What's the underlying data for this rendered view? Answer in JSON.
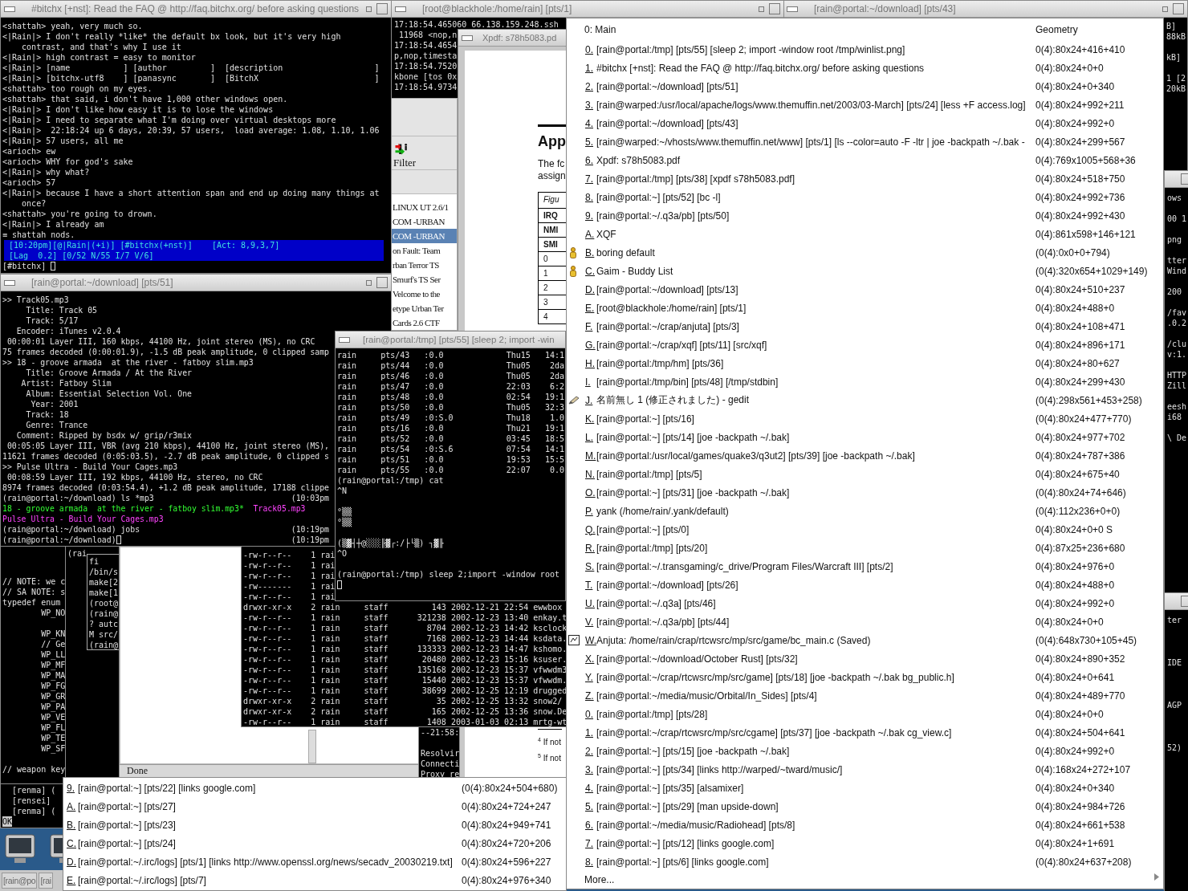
{
  "irc_window": {
    "title": "#bitchx [+nst]: Read the FAQ @ http://faq.bitchx.org/ before asking questions",
    "lines": [
      "<shattah> yeah, very much so.",
      "<|Rain|> I don't really *like* the default bx look, but it's very high",
      "    contrast, and that's why I use it",
      "<|Rain|> high contrast = easy to monitor",
      "<|Rain|> [name           ] [author         ]  [description                   ]",
      "<|Rain|> [bitchx-utf8    ] [panasync       ]  [BitchX                        ]",
      "<shattah> too rough on my eyes.",
      "<shattah> that said, i don't have 1,000 other windows open.",
      "<|Rain|> I don't like how easy it is to lose the windows",
      "<|Rain|> I need to separate what I'm doing over virtual desktops more",
      "<|Rain|>  22:18:24 up 6 days, 20:39, 57 users,  load average: 1.08, 1.10, 1.06",
      "<|Rain|> 57 users, all me",
      "<arioch> ew",
      "<arioch> WHY for god's sake",
      "<|Rain|> why what?",
      "<arioch> 57",
      "<|Rain|> because I have a short attention span and end up doing many things at",
      "    once?",
      "<shattah> you're going to drown.",
      "<|Rain|> I already am",
      "≡ shattah nods."
    ],
    "status_lines": [
      " [10:20pm][@|Rain|(+i)] [#bitchx(+nst)]    [Act: 8,9,3,7]",
      " [Lag  0.2] [0/52 N/55 I/7 V/6]"
    ],
    "prompt": "[#bitchx]"
  },
  "mp3_window": {
    "title": "[rain@portal:~/download] [pts/51]",
    "lines": [
      {
        "kind": "text",
        "text": ">> Track05.mp3"
      },
      {
        "kind": "text",
        "text": "     Title: Track 05"
      },
      {
        "kind": "text",
        "text": "     Track: 5/17"
      },
      {
        "kind": "text",
        "text": "   Encoder: iTunes v2.0.4"
      },
      {
        "kind": "text",
        "text": " 00:00:01 Layer III, 160 kbps, 44100 Hz, joint stereo (MS), no CRC"
      },
      {
        "kind": "text",
        "text": "75 frames decoded (0:00:01.9), -1.5 dB peak amplitude, 0 clipped samp"
      },
      {
        "kind": "text",
        "text": ">> 18 - groove armada  at the river - fatboy slim.mp3"
      },
      {
        "kind": "text",
        "text": "     Title: Groove Armada / At the River"
      },
      {
        "kind": "text",
        "text": "    Artist: Fatboy Slim"
      },
      {
        "kind": "text",
        "text": "     Album: Essential Selection Vol. One"
      },
      {
        "kind": "text",
        "text": "      Year: 2001"
      },
      {
        "kind": "text",
        "text": "     Track: 18"
      },
      {
        "kind": "text",
        "text": "     Genre: Trance"
      },
      {
        "kind": "text",
        "text": "   Comment: Ripped by bsdx w/ grip/r3mix"
      },
      {
        "kind": "text",
        "text": " 00:05:05 Layer III, VBR (avg 210 kbps), 44100 Hz, joint stereo (MS),"
      },
      {
        "kind": "text",
        "text": "11621 frames decoded (0:05:03.5), -2.7 dB peak amplitude, 0 clipped s"
      },
      {
        "kind": "text",
        "text": ">> Pulse Ultra - Build Your Cages.mp3"
      },
      {
        "kind": "text",
        "text": " 00:08:59 Layer III, 192 kbps, 44100 Hz, stereo, no CRC"
      },
      {
        "kind": "text",
        "text": "8974 frames decoded (0:03:54.4), +1.2 dB peak amplitude, 17188 clippe"
      },
      {
        "kind": "prompt",
        "text": "(rain@portal:~/download) ls *mp3",
        "time": "(10:03pm",
        "cursor": false
      },
      {
        "kind": "files",
        "files": [
          {
            "name": "18 - groove armada  at the river - fatboy slim.mp3*",
            "color": "#33ff33"
          },
          {
            "name": "Track05.mp3",
            "color": "#ff44ff"
          }
        ]
      },
      {
        "kind": "files",
        "files": [
          {
            "name": "Pulse Ultra - Build Your Cages.mp3",
            "color": "#ff44ff"
          }
        ]
      },
      {
        "kind": "prompt",
        "text": "(rain@portal:~/download) jobs",
        "time": "(10:19pm",
        "cursor": false
      },
      {
        "kind": "prompt",
        "text": "(rain@portal:~/download)",
        "time": "(10:19pm",
        "cursor": true
      }
    ]
  },
  "tcpdump_window": {
    "title": "[root@blackhole:/home/rain] [pts/1]",
    "lines": [
      "17:18:54.465060 66.138.159.248.ssh",
      " 11968 <nop,n",
      "17:18:54.4654",
      "p,nop,timesta",
      "17:18:54.7520",
      "kbone [tos 0x",
      "17:18:54.9734"
    ]
  },
  "download_window": {
    "title": "[rain@portal:~/download] [pts/43]",
    "blocks": [
      [
        "B]",
        "88kB"
      ],
      [
        "kB]"
      ],
      [
        "1 [2",
        "20kB"
      ]
    ]
  },
  "server_browser": {
    "toolbar_label": "Filter",
    "rows": [
      {
        "text": "LINUX UT 2.6/1",
        "selected": false
      },
      {
        "text": "COM -URBAN",
        "selected": false
      },
      {
        "text": "COM -URBAN",
        "selected": true
      },
      {
        "text": "on Fault: Team",
        "selected": false
      },
      {
        "text": "rban Terror TS",
        "selected": false
      },
      {
        "text": "Smurf's TS Ser",
        "selected": false
      },
      {
        "text": "Velcome to the",
        "selected": false
      },
      {
        "text": "etype Urban Ter",
        "selected": false
      },
      {
        "text": "Cards 2.6 CTF",
        "selected": false
      }
    ]
  },
  "xpdf_window": {
    "title": "Xpdf: s78h5083.pd",
    "heading": "App",
    "paragraph": [
      "The fc",
      "assign"
    ],
    "table_rows": [
      "Figu",
      "IRQ",
      "NMI",
      "SMI",
      "0",
      "1",
      "2",
      "3",
      "4"
    ],
    "footnotes": [
      {
        "mark": "4",
        "text": "If not"
      },
      {
        "mark": "5",
        "text": "If not"
      }
    ]
  },
  "who_window": {
    "title": "[rain@portal:/tmp] [pts/55] [sleep 2; import -win",
    "blocks": [
      [
        "rain     pts/43   :0.0             Thu15   14:1",
        "rain     pts/44   :0.0             Thu05    2da",
        "rain     pts/46   :0.0             Thu05    2da",
        "rain     pts/47   :0.0             22:03    6:2",
        "rain     pts/48   :0.0             02:54   19:1",
        "rain     pts/50   :0.0             Thu05   32:3",
        "rain     pts/49   :0:S.0           Thu18    1.0",
        "rain     pts/16   :0.0             Thu21   19:1",
        "rain     pts/52   :0.0             03:45   18:5",
        "rain     pts/54   :0:S.6           07:54   14:1",
        "rain     pts/51   :0.0             19:53   15:5",
        "rain     pts/55   :0.0             22:07    0.0",
        "(rain@portal:/tmp) cat",
        "^N"
      ],
      [
        "°▒▒",
        "°▒▒"
      ],
      [
        "(▒▓┤┼@░░░╟▓┌:/├└▒) ┐▓╟",
        "^O"
      ],
      [
        "(rain@portal:/tmp) sleep 2;import -window root"
      ]
    ],
    "cursor": true
  },
  "ls_window": {
    "lines": [
      "-rw-r--r--    1 rai",
      "-rw-r--r--    1 rai",
      "-rw-r--r--    1 rai",
      "-rw-------    1 rai",
      "-rw-r--r--    1 rai",
      "drwxr-xr-x    2 rain     staff         143 2002-12-21 22:54 ewwbox",
      "-rw-r--r--    1 rain     staff      321238 2002-12-23 13:40 enkay.t",
      "-rw-r--r--    1 rain     staff        8704 2002-12-23 14:42 ksclock",
      "-rw-r--r--    1 rain     staff        7168 2002-12-23 14:44 ksdata.",
      "-rw-r--r--    1 rain     staff      133333 2002-12-23 14:47 kshomo.",
      "-rw-r--r--    1 rain     staff       20480 2002-12-23 15:16 ksuser.",
      "-rw-r--r--    1 rain     staff      135168 2002-12-23 15:37 vfwwdm3",
      "-rw-r--r--    1 rain     staff       15440 2002-12-23 15:37 vfwwdm.",
      "-rw-r--r--    1 rain     staff       38699 2002-12-25 12:19 drugged",
      "drwxr-xr-x    2 rain     staff          35 2002-12-25 13:32 snow2/",
      "drwxr-xr-x    2 rain     staff         165 2002-12-25 13:36 snow.De",
      "-rw-r--r--    1 rain     staff        1408 2003-01-03 02:13 mrtg-wt"
    ]
  },
  "code_window": {
    "blocks": [
      [
        "// NOTE: we c",
        "// SA NOTE: s",
        "typedef enum",
        "        WP_NO"
      ],
      [
        "        WP_KN",
        "        // Ge",
        "        WP_LL",
        "        WP_MF",
        "        WP_MA",
        "        WP_FG",
        "        WP_GR",
        "        WP_PA",
        "        WP_VE",
        "        WP_FL",
        "        WP_TE",
        "        WP_SF"
      ],
      [
        "// weapon key"
      ]
    ]
  },
  "shell_window": {
    "lines": [
      "(rai"
    ]
  },
  "make_window": {
    "lines": [
      "fi",
      "/bin/s",
      "make[2",
      "make[1",
      "(root@",
      "(rain@",
      "? autc",
      "M src/",
      "(rain@"
    ]
  },
  "web_browser": {
    "status": "Done"
  },
  "proxy_window": {
    "blocks": [
      [
        "--21:58:"
      ],
      [
        "Resolvir",
        "Connecti",
        "Proxy re"
      ]
    ]
  },
  "nick_window": {
    "lines": [
      "  [renma] (",
      "  [rensei]",
      "  [renma] (",
      "OK"
    ]
  },
  "side_windows": [
    {
      "blocks": [
        [
          "ows"
        ],
        [
          "00 1"
        ],
        [
          "png"
        ],
        [
          "tter",
          "Wind"
        ],
        [
          "200"
        ],
        [
          "/fav",
          ".0.2"
        ],
        [
          "/clu",
          "v:1."
        ],
        [
          "HTTP",
          "Zill"
        ],
        [
          "eesh",
          "i68"
        ],
        [
          "\\ De"
        ]
      ]
    },
    {
      "blocks": [
        [
          "ter"
        ],
        [
          "IDE"
        ],
        [
          "AGP"
        ],
        [
          "52)"
        ]
      ]
    }
  ],
  "window_menu": {
    "header": {
      "title": "0: Main",
      "column": "Geometry"
    },
    "items": [
      {
        "kind": "plain",
        "key": "0.",
        "label": "[rain@portal:/tmp] [pts/55] [sleep 2; import -window root /tmp/winlist.png]",
        "geometry": "0(4):80x24+416+410"
      },
      {
        "kind": "plain",
        "key": "1.",
        "label": "#bitchx [+nst]: Read the FAQ @ http://faq.bitchx.org/ before asking questions",
        "geometry": "0(4):80x24+0+0"
      },
      {
        "kind": "plain",
        "key": "2.",
        "label": "[rain@portal:~/download] [pts/51]",
        "geometry": "0(4):80x24+0+340"
      },
      {
        "kind": "plain",
        "key": "3.",
        "label": "[rain@warped:/usr/local/apache/logs/www.themuffin.net/2003/03-March] [pts/24] [less +F access.log]",
        "geometry": "0(4):80x24+992+211"
      },
      {
        "kind": "plain",
        "key": "4.",
        "label": "[rain@portal:~/download] [pts/43]",
        "geometry": "0(4):80x24+992+0"
      },
      {
        "kind": "plain",
        "key": "5.",
        "label": "[rain@warped:~/vhosts/www.themuffin.net/www] [pts/1] [ls --color=auto -F -ltr | joe -backpath ~/.bak -",
        "geometry": "0(4):80x24+299+567"
      },
      {
        "kind": "plain",
        "key": "6.",
        "label": "Xpdf: s78h5083.pdf",
        "geometry": "0(4):769x1005+568+36"
      },
      {
        "kind": "plain",
        "key": "7.",
        "label": "[rain@portal:/tmp] [pts/38] [xpdf s78h5083.pdf]",
        "geometry": "0(4):80x24+518+750"
      },
      {
        "kind": "plain",
        "key": "8.",
        "label": "[rain@portal:~] [pts/52] [bc -l]",
        "geometry": "0(4):80x24+992+736"
      },
      {
        "kind": "plain",
        "key": "9.",
        "label": "[rain@portal:~/.q3a/pb] [pts/50]",
        "geometry": "0(4):80x24+992+430"
      },
      {
        "kind": "plain",
        "key": "A.",
        "label": "XQF",
        "geometry": "0(4):861x598+146+121"
      },
      {
        "kind": "chat",
        "key": "B.",
        "label": "boring default",
        "geometry": "(0(4):0x0+0+794)"
      },
      {
        "kind": "chat",
        "key": "C.",
        "label": "Gaim - Buddy List",
        "geometry": "(0(4):320x654+1029+149)"
      },
      {
        "kind": "plain",
        "key": "D.",
        "label": "[rain@portal:~/download] [pts/13]",
        "geometry": "0(4):80x24+510+237"
      },
      {
        "kind": "plain",
        "key": "E.",
        "label": "[root@blackhole:/home/rain] [pts/1]",
        "geometry": "0(4):80x24+488+0"
      },
      {
        "kind": "plain",
        "key": "F.",
        "label": "[rain@portal:~/crap/anjuta] [pts/3]",
        "geometry": "0(4):80x24+108+471"
      },
      {
        "kind": "plain",
        "key": "G.",
        "label": "[rain@portal:~/crap/xqf] [pts/11] [src/xqf]",
        "geometry": "0(4):80x24+896+171"
      },
      {
        "kind": "plain",
        "key": "H.",
        "label": "[rain@portal:/tmp/hm] [pts/36]",
        "geometry": "0(4):80x24+80+627"
      },
      {
        "kind": "plain",
        "key": "I.",
        "label": "[rain@portal:/tmp/bin] [pts/48] [/tmp/stdbin]",
        "geometry": "0(4):80x24+299+430"
      },
      {
        "kind": "editor",
        "key": "J.",
        "label": "名前無し 1 (修正されました) - gedit",
        "geometry": "(0(4):298x561+453+258)"
      },
      {
        "kind": "plain",
        "key": "K.",
        "label": "[rain@portal:~] [pts/16]",
        "geometry": "(0(4):80x24+477+770)"
      },
      {
        "kind": "plain",
        "key": "L.",
        "label": "[rain@portal:~] [pts/14] [joe -backpath ~/.bak]",
        "geometry": "0(4):80x24+977+702"
      },
      {
        "kind": "plain",
        "key": "M.",
        "label": "[rain@portal:/usr/local/games/quake3/q3ut2] [pts/39] [joe -backpath ~/.bak]",
        "geometry": "0(4):80x24+787+386"
      },
      {
        "kind": "plain",
        "key": "N.",
        "label": "[rain@portal:/tmp] [pts/5]",
        "geometry": "0(4):80x24+675+40"
      },
      {
        "kind": "plain",
        "key": "O.",
        "label": "[rain@portal:~] [pts/31] [joe -backpath ~/.bak]",
        "geometry": "(0(4):80x24+74+646)"
      },
      {
        "kind": "plain",
        "key": "P.",
        "label": "yank (/home/rain/.yank/default)",
        "geometry": "(0(4):112x236+0+0)"
      },
      {
        "kind": "plain",
        "key": "Q.",
        "label": "[rain@portal:~] [pts/0]",
        "geometry": "0(4):80x24+0+0 S"
      },
      {
        "kind": "plain",
        "key": "R.",
        "label": "[rain@portal:/tmp] [pts/20]",
        "geometry": "0(4):87x25+236+680"
      },
      {
        "kind": "plain",
        "key": "S.",
        "label": "[rain@portal:~/.transgaming/c_drive/Program Files/Warcraft III] [pts/2]",
        "geometry": "0(4):80x24+976+0"
      },
      {
        "kind": "plain",
        "key": "T.",
        "label": "[rain@portal:~/download] [pts/26]",
        "geometry": "0(4):80x24+488+0"
      },
      {
        "kind": "plain",
        "key": "U.",
        "label": "[rain@portal:~/.q3a] [pts/46]",
        "geometry": "0(4):80x24+992+0"
      },
      {
        "kind": "plain",
        "key": "V.",
        "label": "[rain@portal:~/.q3a/pb] [pts/44]",
        "geometry": "0(4):80x24+0+0"
      },
      {
        "kind": "ide",
        "key": "W.",
        "label": "Anjuta: /home/rain/crap/rtcwsrc/mp/src/game/bc_main.c (Saved)",
        "geometry": "(0(4):648x730+105+45)"
      },
      {
        "kind": "plain",
        "key": "X.",
        "label": "[rain@portal:~/download/October Rust] [pts/32]",
        "geometry": "0(4):80x24+890+352"
      },
      {
        "kind": "plain",
        "key": "Y.",
        "label": "[rain@portal:~/crap/rtcwsrc/mp/src/game] [pts/18] [joe -backpath ~/.bak bg_public.h]",
        "geometry": "0(4):80x24+0+641"
      },
      {
        "kind": "plain",
        "key": "Z.",
        "label": "[rain@portal:~/media/music/Orbital/In_Sides] [pts/4]",
        "geometry": "0(4):80x24+489+770"
      },
      {
        "kind": "plain",
        "key": "0.",
        "label": "[rain@portal:/tmp] [pts/28]",
        "geometry": "0(4):80x24+0+0"
      },
      {
        "kind": "plain",
        "key": "1.",
        "label": "[rain@portal:~/crap/rtcwsrc/mp/src/cgame] [pts/37] [joe -backpath ~/.bak cg_view.c]",
        "geometry": "0(4):80x24+504+641"
      },
      {
        "kind": "plain",
        "key": "2.",
        "label": "[rain@portal:~] [pts/15] [joe -backpath ~/.bak]",
        "geometry": "0(4):80x24+992+0"
      },
      {
        "kind": "plain",
        "key": "3.",
        "label": "[rain@portal:~] [pts/34] [links http://warped/~tward/music/]",
        "geometry": "0(4):168x24+272+107"
      },
      {
        "kind": "plain",
        "key": "4.",
        "label": "[rain@portal:~] [pts/35] [alsamixer]",
        "geometry": "0(4):80x24+0+340"
      },
      {
        "kind": "plain",
        "key": "5.",
        "label": "[rain@portal:~] [pts/29] [man upside-down]",
        "geometry": "0(4):80x24+984+726"
      },
      {
        "kind": "plain",
        "key": "6.",
        "label": "[rain@portal:~/media/music/Radiohead] [pts/8]",
        "geometry": "0(4):80x24+661+538"
      },
      {
        "kind": "plain",
        "key": "7.",
        "label": "[rain@portal:~] [pts/12] [links google.com]",
        "geometry": "0(4):80x24+1+691"
      },
      {
        "kind": "plain",
        "key": "8.",
        "label": "[rain@portal:~] [pts/6] [links google.com]",
        "geometry": "(0(4):80x24+637+208)"
      }
    ],
    "more": "More..."
  },
  "bottom_menu": {
    "items": [
      {
        "key": "9.",
        "label": "[rain@portal:~] [pts/22] [links google.com]",
        "geometry": "(0(4):80x24+504+680)"
      },
      {
        "key": "A.",
        "label": "[rain@portal:~] [pts/27]",
        "geometry": "0(4):80x24+724+247"
      },
      {
        "key": "B.",
        "label": "[rain@portal:~] [pts/23]",
        "geometry": "0(4):80x24+949+741"
      },
      {
        "key": "C.",
        "label": "[rain@portal:~] [pts/24]",
        "geometry": "0(4):80x24+720+206"
      },
      {
        "key": "D.",
        "label": "[rain@portal:~/.irc/logs] [pts/1] [links http://www.openssl.org/news/secadv_20030219.txt]",
        "geometry": "0(4):80x24+596+227"
      },
      {
        "key": "E.",
        "label": "[rain@portal:~/.irc/logs] [pts/7]",
        "geometry": "0(4):80x24+976+340"
      }
    ]
  },
  "taskbar": {
    "buttons": [
      "[rain@po",
      "[rai"
    ]
  }
}
